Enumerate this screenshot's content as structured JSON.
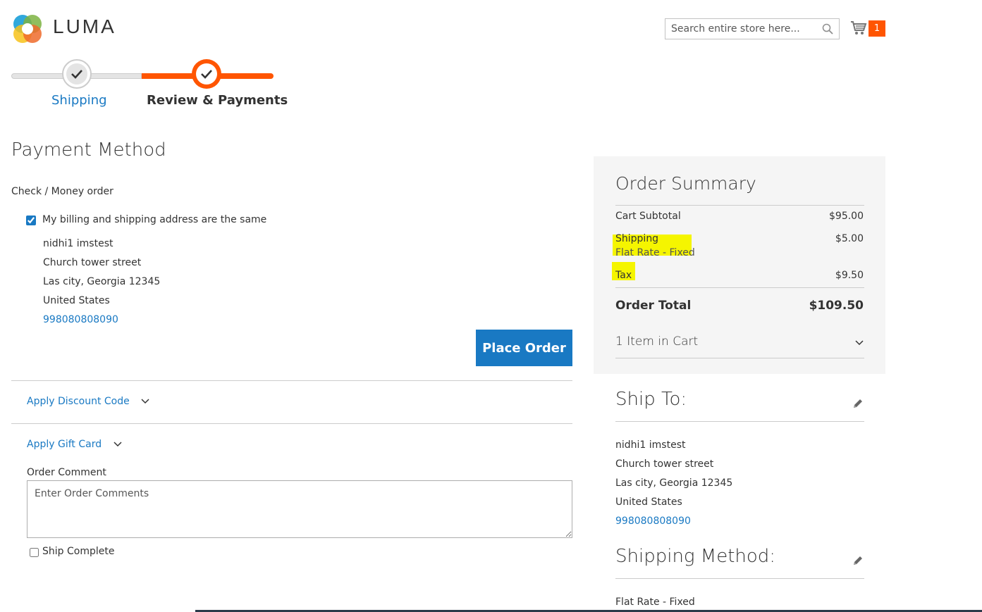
{
  "header": {
    "logo_text": "LUMA",
    "search_placeholder": "Search entire store here...",
    "cart_count": "1"
  },
  "progress": {
    "steps": [
      {
        "label": "Shipping",
        "state": "complete"
      },
      {
        "label": "Review & Payments",
        "state": "active"
      }
    ]
  },
  "payment": {
    "title": "Payment Method",
    "method_name": "Check / Money order",
    "billing_same_label": "My billing and shipping address are the same",
    "billing_same_checked": true,
    "address": {
      "name": "nidhi1 imstest",
      "street": "Church tower street",
      "city_line": "Las city, Georgia 12345",
      "country": "United States",
      "phone": "998080808090"
    },
    "place_order_label": "Place Order",
    "discount_label": "Apply Discount Code",
    "gift_card_label": "Apply Gift Card",
    "comment_label": "Order Comment",
    "comment_placeholder": "Enter Order Comments",
    "ship_complete_label": "Ship Complete"
  },
  "summary": {
    "title": "Order Summary",
    "subtotal_label": "Cart Subtotal",
    "subtotal_value": "$95.00",
    "shipping_label": "Shipping",
    "shipping_method": "Flat Rate - Fixed",
    "shipping_value": "$5.00",
    "tax_label": "Tax",
    "tax_value": "$9.50",
    "total_label": "Order Total",
    "total_value": "$109.50",
    "items_label": "1 Item in Cart"
  },
  "ship_to": {
    "title": "Ship To:",
    "name": "nidhi1 imstest",
    "street": "Church tower street",
    "city_line": "Las city, Georgia 12345",
    "country": "United States",
    "phone": "998080808090"
  },
  "shipping_method": {
    "title": "Shipping Method:",
    "value": "Flat Rate - Fixed"
  },
  "colors": {
    "accent": "#1979c3",
    "brand_orange": "#ff5501",
    "highlight": "#f5f500"
  }
}
